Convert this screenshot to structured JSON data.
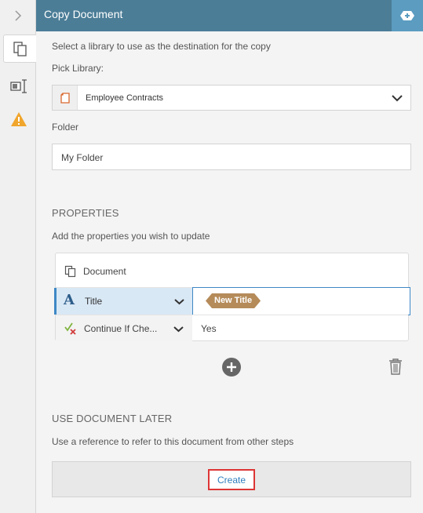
{
  "header": {
    "title": "Copy Document",
    "add_icon": "add-step-icon"
  },
  "rail": {
    "items": [
      {
        "name": "collapse-chevron-icon"
      },
      {
        "name": "copy-document-icon",
        "active": true
      },
      {
        "name": "field-mapping-icon"
      },
      {
        "name": "warning-icon"
      }
    ]
  },
  "library": {
    "intro": "Select a library to use as the destination for the copy",
    "pick_label": "Pick Library:",
    "selected": "Employee Contracts"
  },
  "folder": {
    "label": "Folder",
    "value": "My Folder"
  },
  "properties": {
    "heading": "PROPERTIES",
    "description": "Add the properties you wish to update",
    "document_label": "Document",
    "rows": [
      {
        "name": "Title",
        "token": "New Title"
      },
      {
        "name": "Continue If Che...",
        "value": "Yes"
      }
    ]
  },
  "later": {
    "heading": "USE DOCUMENT LATER",
    "description": "Use a reference to refer to this document from other steps",
    "create_label": "Create"
  },
  "colors": {
    "header": "#4b7d97",
    "accent": "#5b9cc0",
    "token": "#b58b5a",
    "highlight": "#dd3535"
  }
}
